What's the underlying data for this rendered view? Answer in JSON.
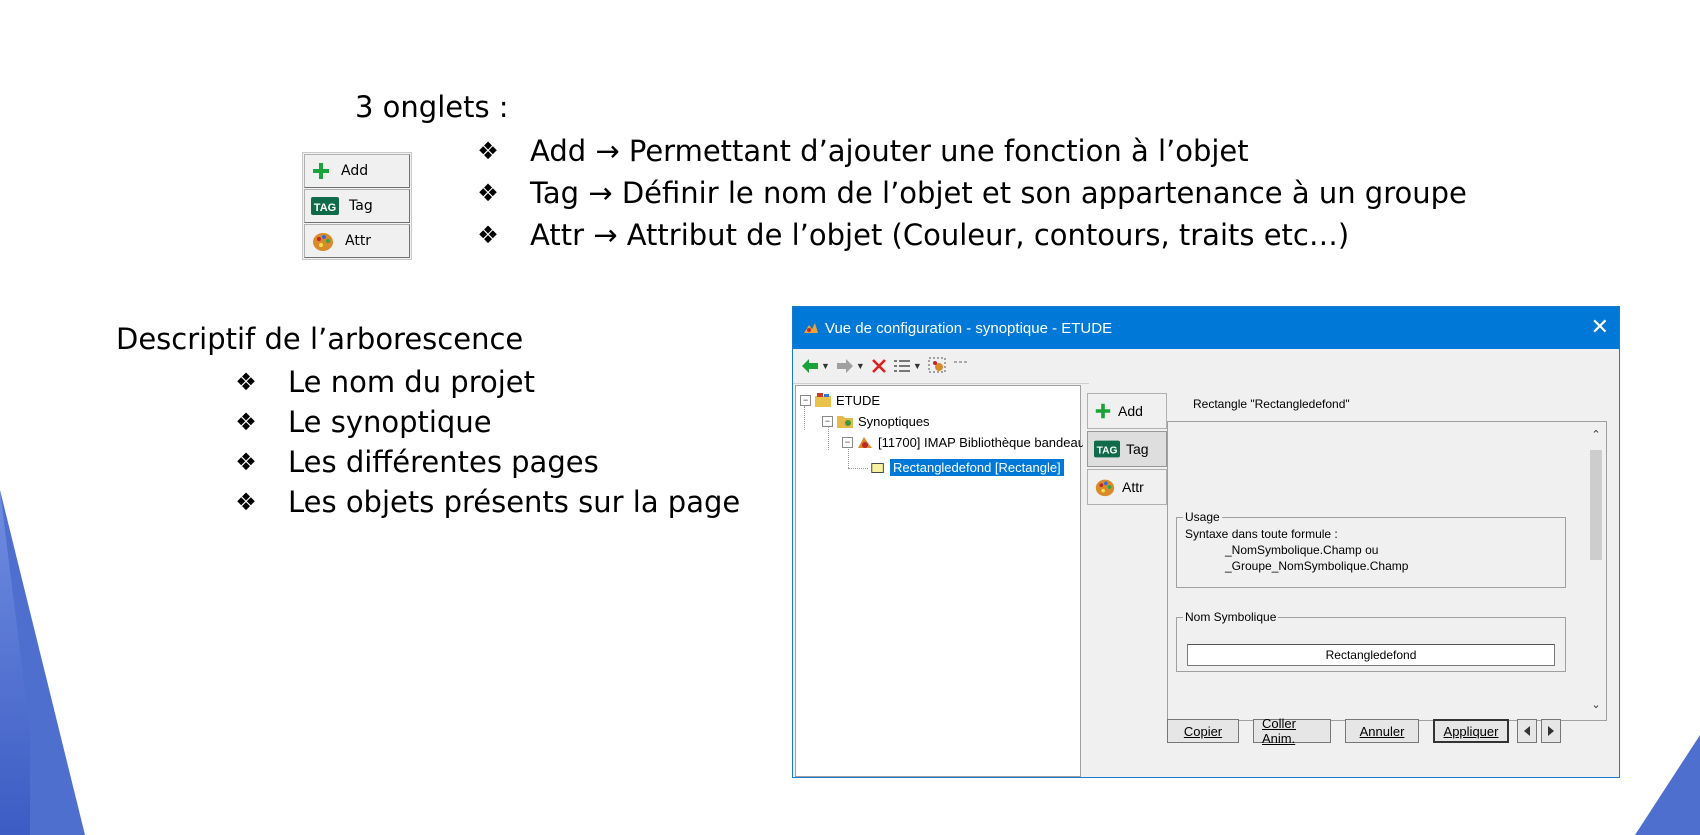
{
  "slide": {
    "tabs_title": "3 onglets :",
    "tab_bullets": [
      "Add → Permettant d’ajouter une fonction à l’objet",
      "Tag → Définir le nom de l’objet et son appartenance à un groupe",
      "Attr → Attribut de l’objet (Couleur, contours, traits etc…)"
    ],
    "mini_tabs": [
      "Add",
      "Tag",
      "Attr"
    ],
    "tree_title": "Descriptif de l’arborescence",
    "tree_bullets": [
      "Le nom du projet",
      "Le synoptique",
      "Les différentes pages",
      "Les objets présents sur la page"
    ],
    "bullet_glyph": "❖"
  },
  "window": {
    "title": "Vue de configuration - synoptique - ETUDE",
    "close": "✕",
    "tree": {
      "root": "ETUDE",
      "synoptiques": "Synoptiques",
      "page": "[11700]  IMAP Bibliothèque bandeau",
      "object": "Rectangledefond [Rectangle]"
    },
    "tabs": [
      "Add",
      "Tag",
      "Attr"
    ],
    "object_name": "Rectangle  \"Rectangledefond\"",
    "usage": {
      "legend": "Usage",
      "line1": "Syntaxe dans toute formule :",
      "line2": "_NomSymbolique.Champ     ou",
      "line3": "_Groupe_NomSymbolique.Champ"
    },
    "nom": {
      "legend": "Nom Symbolique",
      "value": "Rectangledefond"
    },
    "buttons": {
      "copier": "Copier",
      "coller": "Coller Anim.",
      "annuler": "Annuler",
      "appliquer": "Appliquer"
    },
    "colors": {
      "titlebar": "#0078d7",
      "selection": "#0078d7"
    }
  }
}
